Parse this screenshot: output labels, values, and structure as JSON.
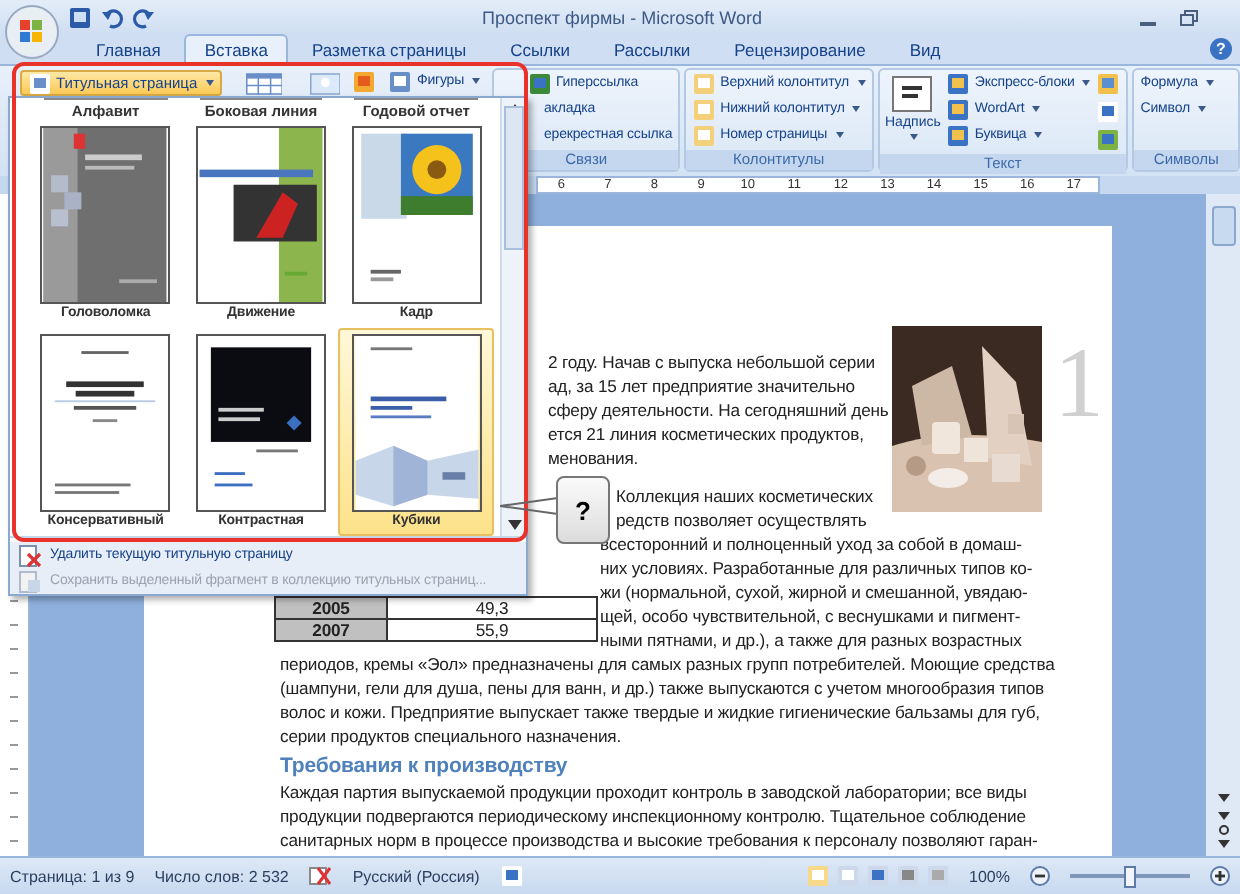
{
  "window": {
    "title": "Проспект фирмы - Microsoft Word"
  },
  "tabs": [
    {
      "label": "Главная",
      "selected": false
    },
    {
      "label": "Вставка",
      "selected": true
    },
    {
      "label": "Разметка страницы",
      "selected": false
    },
    {
      "label": "Ссылки",
      "selected": false
    },
    {
      "label": "Рассылки",
      "selected": false
    },
    {
      "label": "Рецензирование",
      "selected": false
    },
    {
      "label": "Вид",
      "selected": false
    }
  ],
  "help": "?",
  "ribbon": {
    "cover_page": {
      "label": "Титульная страница",
      "expanded": true
    },
    "shapes": "Фигуры",
    "links": {
      "items": [
        "Гиперссылка",
        "акладка",
        "ерекрестная ссылка"
      ],
      "group": "Связи"
    },
    "headers": {
      "items": [
        "Верхний колонтитул",
        "Нижний колонтитул",
        "Номер страницы"
      ],
      "group": "Колонтитулы"
    },
    "text": {
      "big": "Надпись",
      "items": [
        "Экспресс-блоки",
        "WordArt",
        "Буквица"
      ],
      "group": "Текст"
    },
    "symbols": {
      "items": [
        "Формула",
        "Символ"
      ],
      "group": "Символы"
    }
  },
  "ruler": [
    "6",
    "7",
    "8",
    "9",
    "10",
    "11",
    "12",
    "13",
    "14",
    "15",
    "16",
    "17"
  ],
  "gallery": {
    "headings": [
      "Алфавит",
      "Боковая линия",
      "Годовой отчет"
    ],
    "items": [
      {
        "label": "Головоломка",
        "kind": "puzzle",
        "selected": false
      },
      {
        "label": "Движение",
        "kind": "motion",
        "selected": false
      },
      {
        "label": "Кадр",
        "kind": "frame",
        "selected": false
      },
      {
        "label": "Консервативный",
        "kind": "conservative",
        "selected": false
      },
      {
        "label": "Контрастная",
        "kind": "contrast",
        "selected": false
      },
      {
        "label": "Кубики",
        "kind": "cubes",
        "selected": true
      }
    ],
    "menu": [
      {
        "label": "Удалить текущую титульную страницу",
        "disabled": false
      },
      {
        "label": "Сохранить выделенный фрагмент в коллекцию титульных страниц...",
        "disabled": true
      }
    ]
  },
  "callout": "?",
  "document": {
    "page_number": "1",
    "intro_lines": [
      "2 году. Начав с выпуска небольшой серии",
      "ад, за 15 лет предприятие значительно",
      "сферу деятельности. На сегодняшний день",
      "ется 21 линия косметических продуктов,",
      "менования."
    ],
    "wrap_lines": [
      "Коллекция наших косметических",
      "редств позволяет осуществлять"
    ],
    "side_lines": [
      "всесторонний и полноценный уход за собой в домаш-",
      "них условиях. Разработанные для различных типов ко-",
      "жи (нормальной, сухой, жирной и смешанной, увядаю-",
      "щей, особо чувствительной, с веснушками и пигмент-",
      "ными пятнами, и др.), а также для разных возрастных"
    ],
    "table_rows": [
      {
        "year": "2005",
        "value": "49,3"
      },
      {
        "year": "2007",
        "value": "55,9"
      }
    ],
    "body_lines": [
      "периодов, кремы «Эол» предназначены для самых разных групп потребителей. Моющие средства",
      "(шампуни, гели для душа, пены для ванн, и др.) также выпускаются с учетом многообразия типов",
      "волос и кожи. Предприятие выпускает также твердые и жидкие гигиенические бальзамы для губ,",
      "серии продуктов специального назначения."
    ],
    "heading": "Требования к производству",
    "section_lines": [
      "Каждая партия выпускаемой продукции проходит контроль в заводской лаборатории; все виды",
      "продукции подвергаются периодическому инспекционному контролю. Тщательное соблюдение",
      "санитарных норм в процессе производства и высокие требования к персоналу позволяют гаран-"
    ]
  },
  "status_bar": {
    "page": "Страница: 1 из 9",
    "words": "Число слов: 2 532",
    "language": "Русский (Россия)",
    "zoom": "100%",
    "zoom_slider": {
      "level": 0.5
    }
  }
}
